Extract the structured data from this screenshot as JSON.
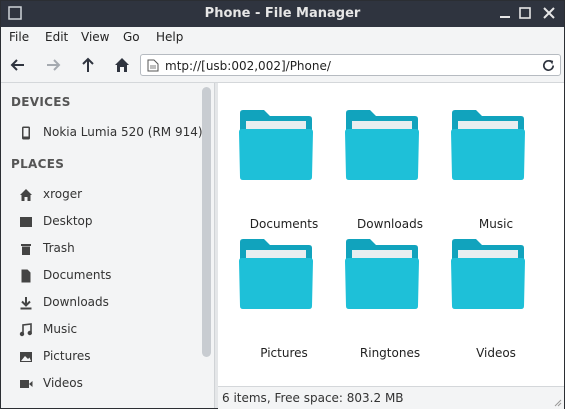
{
  "window": {
    "title": "Phone - File Manager"
  },
  "menubar": {
    "items": [
      "File",
      "Edit",
      "View",
      "Go",
      "Help"
    ]
  },
  "toolbar": {
    "address": "mtp://[usb:002,002]/Phone/"
  },
  "sidebar": {
    "devices_heading": "DEVICES",
    "devices": [
      {
        "label": "Nokia Lumia 520 (RM 914)",
        "icon": "phone-icon"
      }
    ],
    "places_heading": "PLACES",
    "places": [
      {
        "label": "xroger",
        "icon": "home-icon"
      },
      {
        "label": "Desktop",
        "icon": "desktop-icon"
      },
      {
        "label": "Trash",
        "icon": "trash-icon"
      },
      {
        "label": "Documents",
        "icon": "document-icon"
      },
      {
        "label": "Downloads",
        "icon": "download-icon"
      },
      {
        "label": "Music",
        "icon": "music-icon"
      },
      {
        "label": "Pictures",
        "icon": "picture-icon"
      },
      {
        "label": "Videos",
        "icon": "video-icon"
      }
    ]
  },
  "files": [
    {
      "name": "Documents"
    },
    {
      "name": "Downloads"
    },
    {
      "name": "Music"
    },
    {
      "name": "Pictures"
    },
    {
      "name": "Ringtones"
    },
    {
      "name": "Videos"
    }
  ],
  "status": {
    "text": "6 items, Free space: 803.2 MB"
  },
  "colors": {
    "titlebar": "#2f343f",
    "folder": "#1ec0d8",
    "folder_tab": "#11a3bd"
  }
}
